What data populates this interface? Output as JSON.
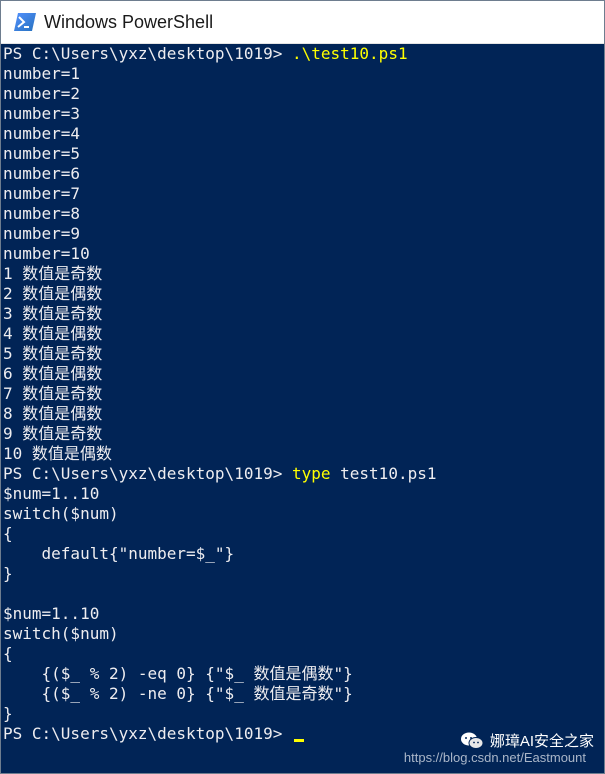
{
  "window": {
    "title": "Windows PowerShell",
    "icon": "powershell-icon",
    "background_color": "#012456",
    "text_color": "#eeedf0",
    "command_color": "#ffff00"
  },
  "console": {
    "first_prompt": "PS C:\\Users\\yxz\\desktop\\1019> ",
    "first_command": ".\\test10.ps1",
    "output_lines": [
      "number=1",
      "number=2",
      "number=3",
      "number=4",
      "number=5",
      "number=6",
      "number=7",
      "number=8",
      "number=9",
      "number=10",
      "1 数值是奇数",
      "2 数值是偶数",
      "3 数值是奇数",
      "4 数值是偶数",
      "5 数值是奇数",
      "6 数值是偶数",
      "7 数值是奇数",
      "8 数值是偶数",
      "9 数值是奇数",
      "10 数值是偶数"
    ],
    "second_prompt": "PS C:\\Users\\yxz\\desktop\\1019> ",
    "second_command_keyword": "type",
    "second_command_arg": " test10.ps1",
    "file_lines": [
      "$num=1..10",
      "switch($num)",
      "{",
      "    default{\"number=$_\"}",
      "}",
      "",
      "$num=1..10",
      "switch($num)",
      "{",
      "    {($_ % 2) -eq 0} {\"$_ 数值是偶数\"}",
      "    {($_ % 2) -ne 0} {\"$_ 数值是奇数\"}",
      "}"
    ],
    "final_prompt": "PS C:\\Users\\yxz\\desktop\\1019> "
  },
  "watermark": {
    "url": "https://blog.csdn.net/Eastmount",
    "brand": "娜璋AI安全之家",
    "icon": "wechat-icon"
  }
}
